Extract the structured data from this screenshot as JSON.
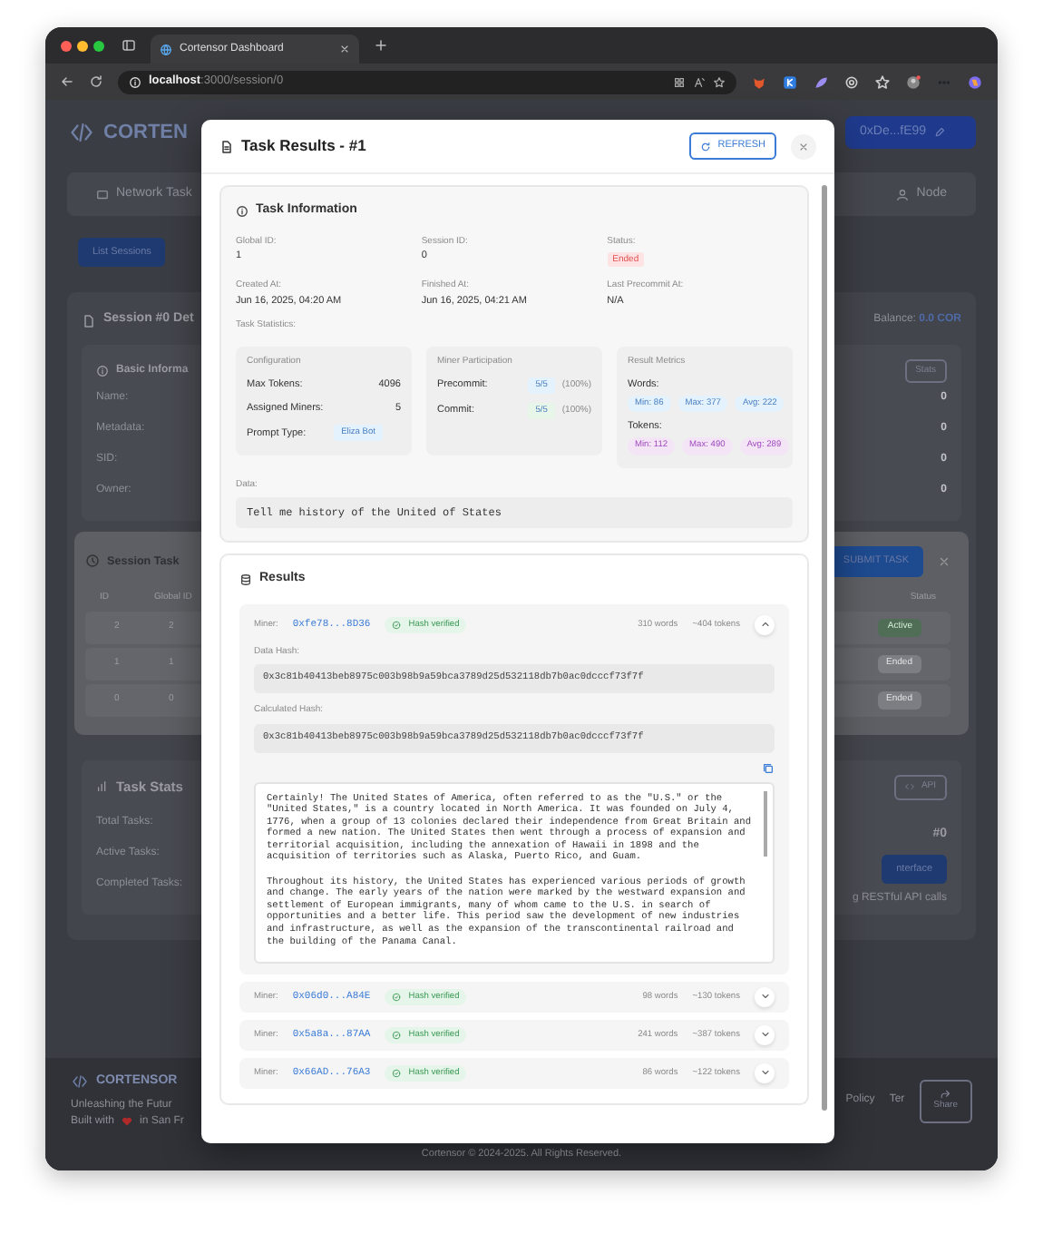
{
  "browser": {
    "tab_title": "Cortensor Dashboard",
    "url_host": "localhost",
    "url_path": ":3000/session/0"
  },
  "background": {
    "brand": "CORTEN",
    "wallet": "0xDe...fE99",
    "nav_left": "Network Task",
    "nav_right": "Node",
    "list_button": "List Sessions",
    "session_title": "Session #0 Det",
    "balance_label": "Balance:",
    "balance_value": "0.0 COR",
    "basic_title": "Basic Informa",
    "stats_button": "Stats",
    "basic_rows": [
      {
        "label": "Name:",
        "value": "0"
      },
      {
        "label": "Metadata:",
        "value": "0"
      },
      {
        "label": "SID:",
        "value": "0"
      },
      {
        "label": "Owner:",
        "value": "0"
      }
    ],
    "tasks_title": "Session Task",
    "submit_button": "SUBMIT TASK",
    "table_columns": [
      "ID",
      "Global ID",
      "Status"
    ],
    "table_rows": [
      {
        "id": "2",
        "global_id": "2",
        "status": "Active"
      },
      {
        "id": "1",
        "global_id": "1",
        "status": "Ended"
      },
      {
        "id": "0",
        "global_id": "0",
        "status": "Ended"
      }
    ],
    "stats_title": "Task Stats",
    "api_button": "API",
    "stats_rows": [
      "Total Tasks:",
      "Active Tasks:",
      "Completed Tasks:"
    ],
    "stats_value": "#0",
    "interface_button": "nterface",
    "api_note": "g RESTful API calls",
    "footer_brand": "CORTENSOR",
    "footer_tagline": "Unleashing the Futur",
    "footer_built": "Built with",
    "footer_place": "in San Fr",
    "footer_links": [
      "Policy",
      "Ter"
    ],
    "share_button": "Share",
    "copyright": "Cortensor © 2024-2025. All Rights Reserved."
  },
  "modal": {
    "title": "Task Results - #1",
    "refresh": "REFRESH",
    "info": {
      "heading": "Task Information",
      "fields": [
        {
          "label": "Global ID:",
          "value": "1",
          "kind": "text"
        },
        {
          "label": "Session ID:",
          "value": "0",
          "kind": "text"
        },
        {
          "label": "Status:",
          "value": "Ended",
          "kind": "badge"
        },
        {
          "label": "Created At:",
          "value": "Jun 16, 2025, 04:20 AM",
          "kind": "text"
        },
        {
          "label": "Finished At:",
          "value": "Jun 16, 2025, 04:21 AM",
          "kind": "text"
        },
        {
          "label": "Last Precommit At:",
          "value": "N/A",
          "kind": "text"
        }
      ],
      "statistics_label": "Task Statistics:",
      "configuration": {
        "heading": "Configuration",
        "rows": [
          {
            "label": "Max Tokens:",
            "value": "4096",
            "kind": "text"
          },
          {
            "label": "Assigned Miners:",
            "value": "5",
            "kind": "text"
          },
          {
            "label": "Prompt Type:",
            "value": "Eliza Bot",
            "kind": "badge"
          }
        ]
      },
      "participation": {
        "heading": "Miner Participation",
        "rows": [
          {
            "label": "Precommit:",
            "value": "5/5",
            "percent": "(100%)",
            "color": "#e3f2fd"
          },
          {
            "label": "Commit:",
            "value": "5/5",
            "percent": "(100%)",
            "color": "#e8f5e9"
          }
        ]
      },
      "metrics": {
        "heading": "Result Metrics",
        "groups": [
          {
            "label": "Words:",
            "color": "#e3f2fd",
            "chips": [
              "Min: 86",
              "Max: 377",
              "Avg: 222"
            ]
          },
          {
            "label": "Tokens:",
            "color": "#f3e5f5",
            "chips": [
              "Min: 112",
              "Max: 490",
              "Avg: 289"
            ]
          }
        ]
      },
      "data_label": "Data:",
      "data_value": "Tell me history of the United of States"
    },
    "results": {
      "heading": "Results",
      "miners": [
        {
          "label": "Miner:",
          "address": "0xfe78...8D36",
          "verified": "Hash verified",
          "words": "310 words",
          "tokens": "~404 tokens",
          "expanded": true,
          "data_hash_label": "Data Hash:",
          "data_hash": "0x3c81b40413beb8975c003b98b9a59bca3789d25d532118db7b0ac0dcccf73f7f",
          "calc_hash_label": "Calculated Hash:",
          "calc_hash": "0x3c81b40413beb8975c003b98b9a59bca3789d25d532118db7b0ac0dcccf73f7f",
          "response": [
            "Certainly! The United States of America, often referred to as the \"U.S.\" or the \"United States,\" is a country located in North America. It was founded on July 4, 1776, when a group of 13 colonies declared their independence from Great Britain and formed a new nation. The United States then went through a process of expansion and territorial acquisition, including the annexation of Hawaii in 1898 and the acquisition of territories such as Alaska, Puerto Rico, and Guam.",
            "Throughout its history, the United States has experienced various periods of growth and change. The early years of the nation were marked by the westward expansion and settlement of European immigrants, many of whom came to the U.S. in search of opportunities and a better life. This period saw the development of new industries and infrastructure, as well as the expansion of the transcontinental railroad and the building of the Panama Canal."
          ]
        },
        {
          "label": "Miner:",
          "address": "0x06d0...A84E",
          "verified": "Hash verified",
          "words": "98 words",
          "tokens": "~130 tokens",
          "expanded": false
        },
        {
          "label": "Miner:",
          "address": "0x5a8a...87AA",
          "verified": "Hash verified",
          "words": "241 words",
          "tokens": "~387 tokens",
          "expanded": false
        },
        {
          "label": "Miner:",
          "address": "0x66AD...76A3",
          "verified": "Hash verified",
          "words": "86 words",
          "tokens": "~122 tokens",
          "expanded": false
        }
      ]
    }
  }
}
